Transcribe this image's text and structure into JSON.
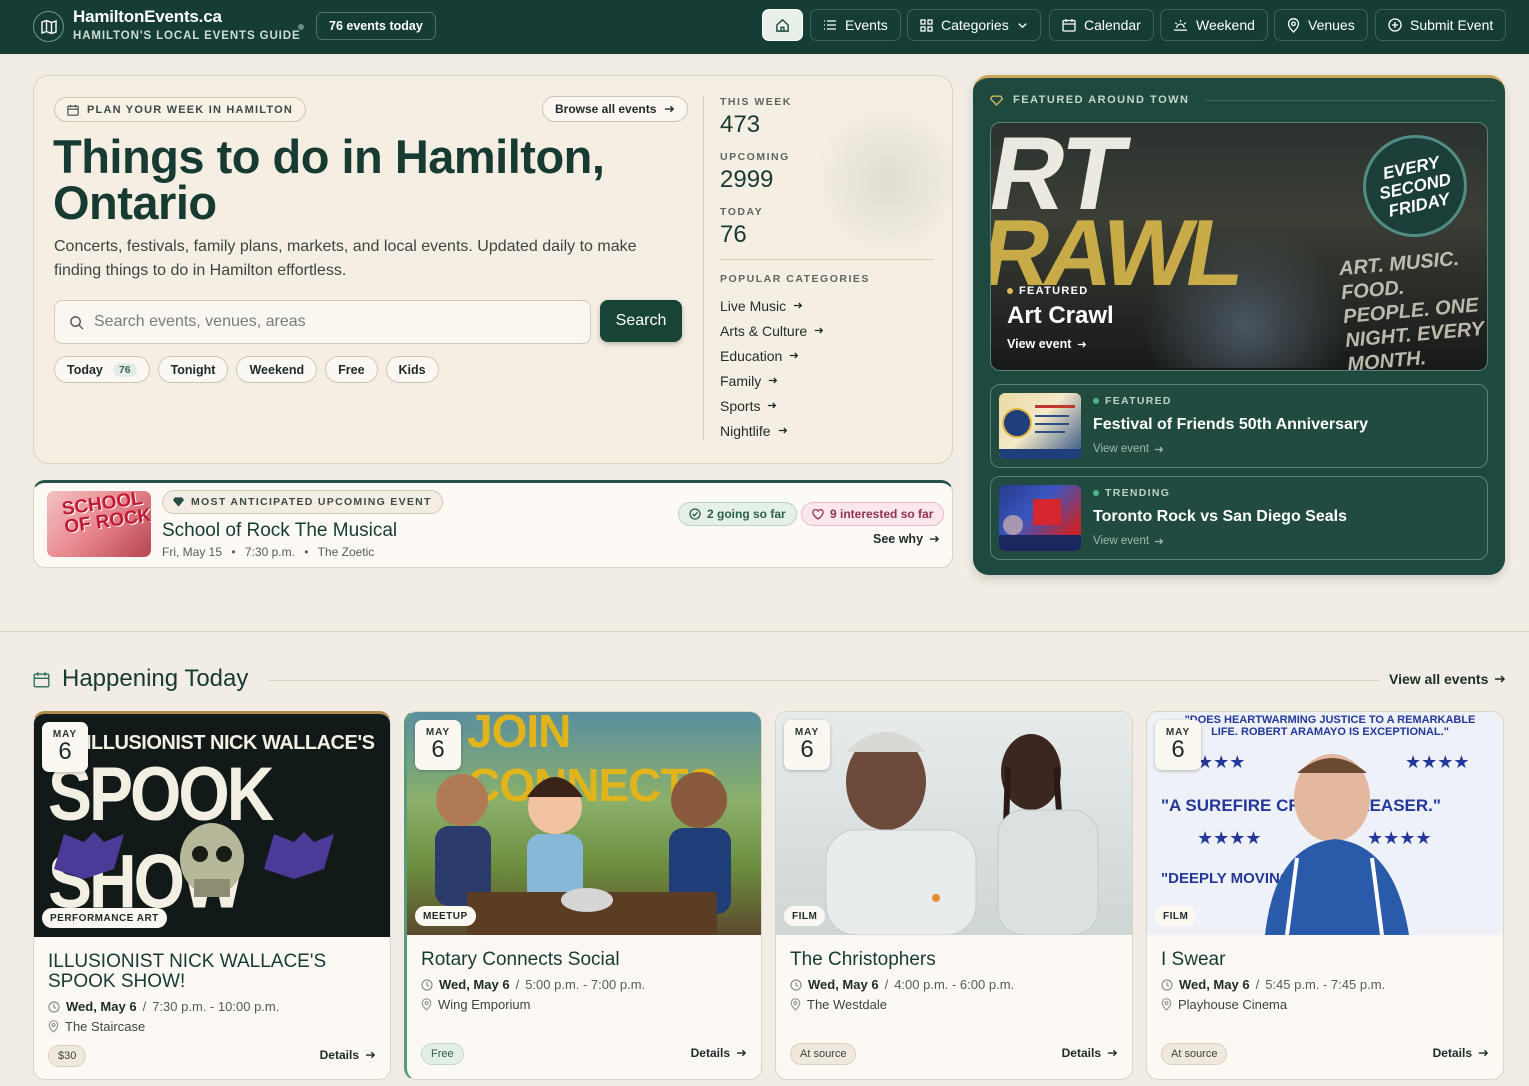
{
  "nav": {
    "brand_name": "HamiltonEvents.ca",
    "brand_sub": "HAMILTON'S LOCAL EVENTS GUIDE",
    "today_pill": "76 events today",
    "items": [
      {
        "label": "Events",
        "icon": "list-icon"
      },
      {
        "label": "Categories",
        "icon": "grid-icon"
      },
      {
        "label": "Calendar",
        "icon": "calendar-icon"
      },
      {
        "label": "Weekend",
        "icon": "sun-icon"
      },
      {
        "label": "Venues",
        "icon": "pin-icon"
      },
      {
        "label": "Submit Event",
        "icon": "plus-circle-icon"
      }
    ]
  },
  "hero": {
    "kicker": "PLAN YOUR WEEK IN HAMILTON",
    "browse": "Browse all events",
    "title": "Things to do in Hamilton, Ontario",
    "lead": "Concerts, festivals, family plans, markets, and local events. Updated daily to make finding things to do in Hamilton effortless.",
    "search_placeholder": "Search events, venues, areas",
    "search_button": "Search",
    "chips": [
      {
        "label": "Today",
        "count": "76"
      },
      {
        "label": "Tonight"
      },
      {
        "label": "Weekend"
      },
      {
        "label": "Free"
      },
      {
        "label": "Kids"
      }
    ],
    "stats": [
      {
        "label": "THIS WEEK",
        "value": "473"
      },
      {
        "label": "UPCOMING",
        "value": "2999"
      },
      {
        "label": "TODAY",
        "value": "76"
      }
    ],
    "popular_label": "POPULAR CATEGORIES",
    "categories": [
      "Live Music",
      "Arts & Culture",
      "Education",
      "Family",
      "Sports",
      "Nightlife"
    ]
  },
  "anticipated": {
    "badge": "MOST ANTICIPATED UPCOMING EVENT",
    "image_text": "SCHOOL OF ROCK",
    "title": "School of Rock The Musical",
    "date": "Fri, May 15",
    "time": "7:30 p.m.",
    "venue": "The Zoetic",
    "going": "2 going so far",
    "interested": "9 interested so far",
    "see_why": "See why"
  },
  "featured": {
    "kicker": "FEATURED AROUND TOWN",
    "main": {
      "label": "FEATURED",
      "title": "Art Crawl",
      "view": "View event",
      "art_top": "RT",
      "art_bottom": "RAWL",
      "badge": "EVERY SECOND FRIDAY",
      "slogan": "ART. MUSIC. FOOD. PEOPLE. ONE NIGHT. EVERY MONTH."
    },
    "rows": [
      {
        "label": "FEATURED",
        "title": "Festival of Friends 50th Anniversary",
        "view": "View event"
      },
      {
        "label": "TRENDING",
        "title": "Toronto Rock vs San Diego Seals",
        "view": "View event"
      }
    ]
  },
  "today": {
    "title": "Happening Today",
    "view_all": "View all events",
    "cards": [
      {
        "month": "MAY",
        "day": "6",
        "tag": "PERFORMANCE ART",
        "title": "ILLUSIONIST NICK WALLACE'S SPOOK SHOW!",
        "date": "Wed, May 6",
        "time": "7:30 p.m. - 10:00 p.m.",
        "venue": "The Staircase",
        "price": "$30",
        "details": "Details",
        "img_top": "ILLUSIONIST NICK WALLACE'S",
        "img_big": "SPOOK SHOW"
      },
      {
        "month": "MAY",
        "day": "6",
        "tag": "MEETUP",
        "title": "Rotary Connects Social",
        "date": "Wed, May 6",
        "time": "5:00 p.m. - 7:00 p.m.",
        "venue": "Wing Emporium",
        "price": "Free",
        "details": "Details",
        "img_top": "JOIN CONNECTS"
      },
      {
        "month": "MAY",
        "day": "6",
        "tag": "FILM",
        "title": "The Christophers",
        "date": "Wed, May 6",
        "time": "4:00 p.m. - 6:00 p.m.",
        "venue": "The Westdale",
        "price": "At source",
        "details": "Details"
      },
      {
        "month": "MAY",
        "day": "6",
        "tag": "FILM",
        "title": "I Swear",
        "date": "Wed, May 6",
        "time": "5:45 p.m. - 7:45 p.m.",
        "venue": "Playhouse Cinema",
        "price": "At source",
        "details": "Details",
        "img_quote1": "\"DOES HEARTWARMING JUSTICE TO A REMARKABLE LIFE. ROBERT ARAMAYO IS EXCEPTIONAL.\"",
        "img_quote2": "\"A SUREFIRE CROWD-PLEASER.\"",
        "img_quote3": "\"DEEPLY MOVING\""
      }
    ]
  },
  "colors": {
    "brand": "#153d35",
    "accent_gold": "#c9a558",
    "page_bg": "#f1ede4"
  }
}
